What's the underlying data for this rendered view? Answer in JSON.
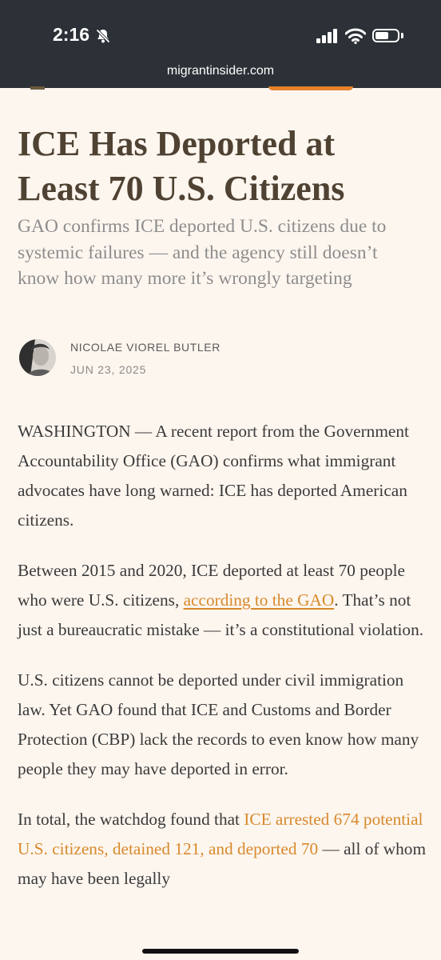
{
  "status_bar": {
    "time": "2:16",
    "url": "migrantinsider.com"
  },
  "article": {
    "title": "ICE Has Deported at Least 70 U.S. Citizens",
    "subtitle": "GAO confirms ICE deported U.S. citizens due to systemic failures — and the agency still doesn’t know how many more it’s wrongly targeting",
    "author": "NICOLAE VIOREL BUTLER",
    "date": "JUN 23, 2025",
    "p1": "WASHINGTON — A recent report from the Government Accountability Office (GAO) confirms what immigrant advocates have long warned: ICE has deported American citizens.",
    "p2_before": "Between 2015 and 2020, ICE deported at least 70 people who were U.S. citizens, ",
    "p2_link": "according to the GAO",
    "p2_after": ". That’s not just a bureaucratic mistake — it’s a constitutional violation.",
    "p3": "U.S. citizens cannot be deported under civil immigration law. Yet GAO found that ICE and Customs and Border Protection (CBP) lack the records to even know how many people they may have deported in error.",
    "p4_before": "In total, the watchdog found that ",
    "p4_link": "ICE arrested 674 potential U.S. citizens, detained 121, and deported 70",
    "p4_after": " — all of whom may have been legally"
  },
  "colors": {
    "status_bg": "#2b3136",
    "page_bg": "#fdf6ef",
    "title": "#4f4232",
    "subtitle": "#8d8d8d",
    "link": "#d8892c",
    "body_text": "#3a3a3a"
  }
}
